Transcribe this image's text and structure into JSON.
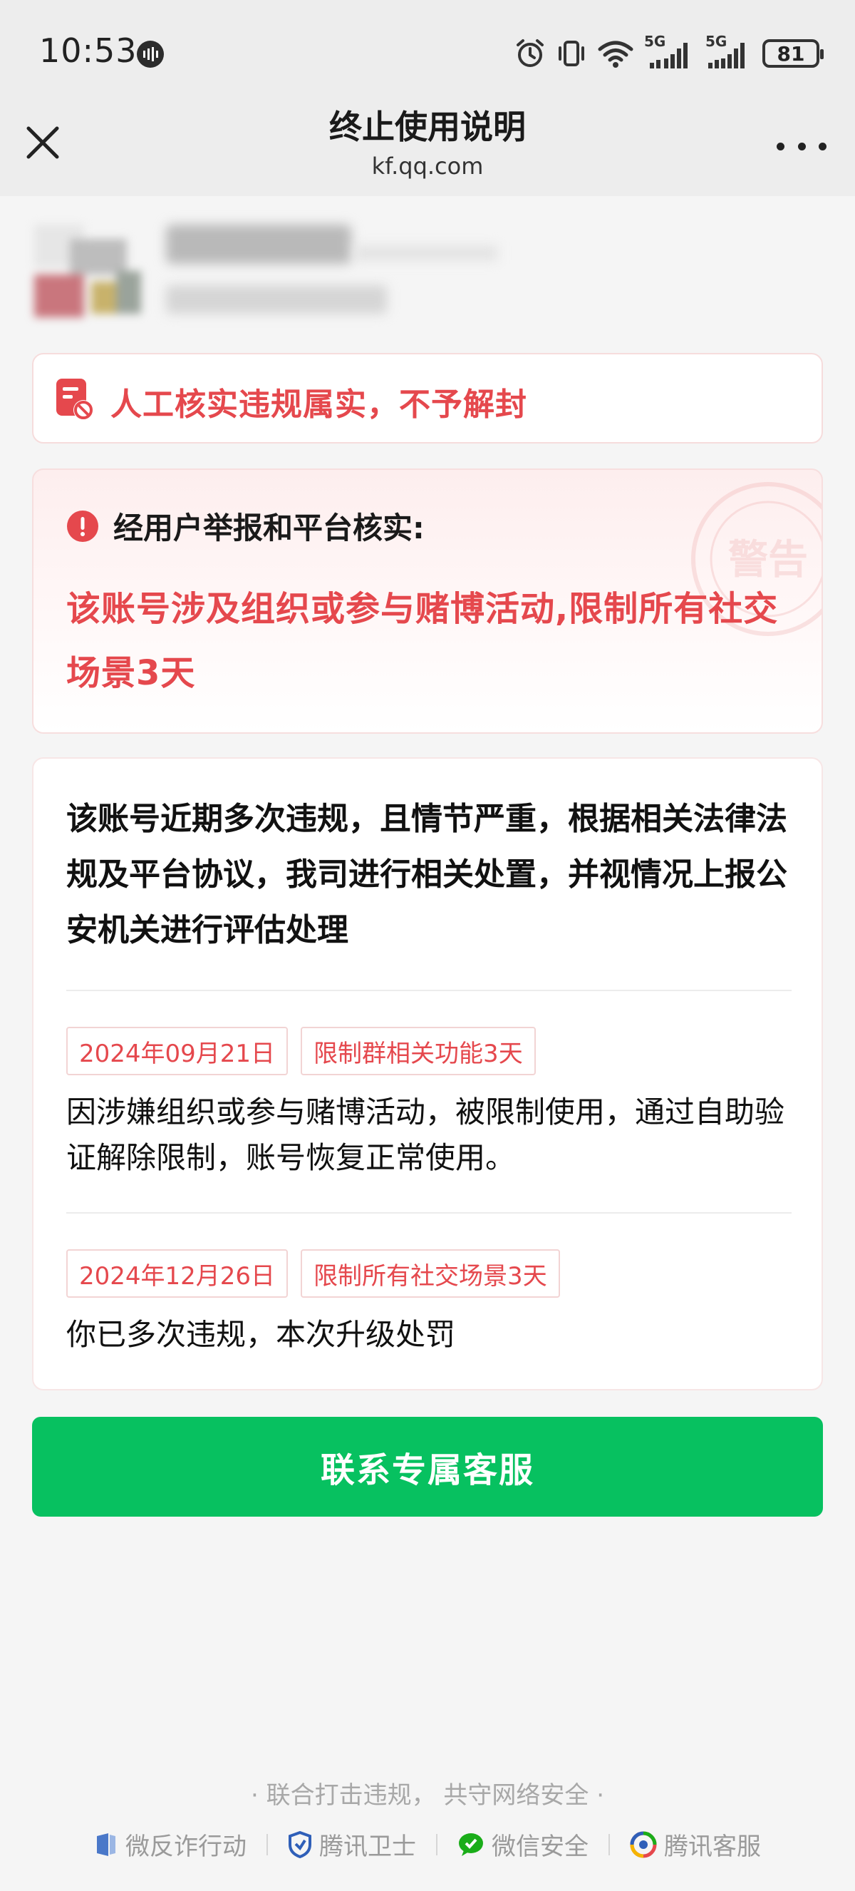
{
  "status_bar": {
    "time": "10:53",
    "network_1": "5G",
    "network_2": "5G",
    "battery": "81"
  },
  "nav": {
    "title": "终止使用说明",
    "subtitle": "kf.qq.com"
  },
  "banner": {
    "text": "人工核实违规属实，不予解封",
    "color": "#e5484d"
  },
  "warning": {
    "heading": "经用户举报和平台核实:",
    "main": "该账号涉及组织或参与赌博活动,限制所有社交场景3天",
    "stamp_text": "警告"
  },
  "detail": {
    "summary": "该账号近期多次违规，且情节严重，根据相关法律法规及平台协议，我司进行相关处置，并视情况上报公安机关进行评估处理",
    "records": [
      {
        "date": "2024年09月21日",
        "penalty": "限制群相关功能3天",
        "description": "因涉嫌组织或参与赌博活动，被限制使用，通过自助验证解除限制，账号恢复正常使用。"
      },
      {
        "date": "2024年12月26日",
        "penalty": "限制所有社交场景3天",
        "description": "你已多次违规，本次升级处罚"
      }
    ]
  },
  "contact_button": {
    "label": "联系专属客服",
    "color": "#07c160"
  },
  "footer": {
    "slogan": "· 联合打击违规， 共守网络安全 ·",
    "partners": [
      {
        "label": "微反诈行动",
        "icon": "anti-fraud-icon"
      },
      {
        "label": "腾讯卫士",
        "icon": "tencent-guard-shield-icon"
      },
      {
        "label": "微信安全",
        "icon": "wechat-security-icon"
      },
      {
        "label": "腾讯客服",
        "icon": "tencent-service-icon"
      }
    ]
  }
}
